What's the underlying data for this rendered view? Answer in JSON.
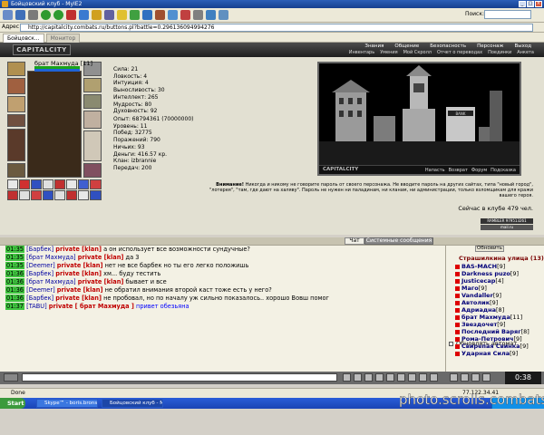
{
  "window": {
    "title": "Бойцовский клуб - MyIE2"
  },
  "search": {
    "label": "Поиск:",
    "value": ""
  },
  "address": {
    "label": "Адрес",
    "url": "http://capitalcity.combats.ru/buttons.pl?battle=0.296136094994276"
  },
  "tabs": [
    {
      "label": "Бойцовск..."
    },
    {
      "label": "Монитор"
    }
  ],
  "game_nav": {
    "logo": "CAPITALCITY",
    "top_links": [
      "Знания",
      "Общение",
      "Безопасность",
      "Персонаж",
      "Выход"
    ],
    "sub_links": [
      "Инвентарь",
      "Умения",
      "Мой Скролл",
      "Отчет о переводах",
      "Поединки",
      "Анкета"
    ]
  },
  "character": {
    "name_line": "брат Махмуда [11]",
    "stats": [
      "Сила: 21",
      "Ловкость: 4",
      "Интуиция: 4",
      "Выносливость: 30",
      "Интеллект: 265",
      "Мудрость: 80",
      "Духовность: 92"
    ],
    "progress": [
      "Опыт: 68794361 (70000000)",
      "Уровень: 11",
      "Побед: 32775",
      "Поражений: 790",
      "Ничьих: 93",
      "Деньги: 416.57 кр.",
      "Клан: izbrannie",
      "Передач: 200"
    ]
  },
  "city": {
    "footer_logo": "CAPITALCITY",
    "footer_links": [
      "Напасть",
      "Возврат",
      "Форум",
      "Подсказка"
    ]
  },
  "warning": {
    "lead": "Внимание!",
    "text": "Никогда и никому не говорите пароль от своего персонажа. Не вводите пароль на других сайтах, типа \"новый город\", \"лотерея\", \"там, где дают на халяву\". Пароль не нужен ни паладинам, ни кланам, ни администрации, только взломщикам для кражи вашего героя."
  },
  "online_count": "Сейчас в клубе 479 чел.",
  "counters": [
    "RAMBLER 979513261",
    "mail.ru"
  ],
  "chat_tabs": {
    "chat": "Чат",
    "system": "Системные сообщения"
  },
  "chat": [
    {
      "time": "01:35",
      "nick": "[Барбек]",
      "priv": "private [klan]",
      "text": "а он использует все возможности сундучные?"
    },
    {
      "time": "01:35",
      "nick": "[брат Махмуда]",
      "priv": "private [klan]",
      "text": "да 3"
    },
    {
      "time": "01:35",
      "nick": "[Deemer]",
      "priv": "private [klan]",
      "text": "нет не все барбек но ты его легко положишь"
    },
    {
      "time": "01:36",
      "nick": "[Барбек]",
      "priv": "private [klan]",
      "text": "хм... буду тестить"
    },
    {
      "time": "01:36",
      "nick": "[брат Махмуда]",
      "priv": "private [klan]",
      "text": "бывает и все"
    },
    {
      "time": "01:36",
      "nick": "[Deemer]",
      "priv": "private [klan]",
      "text": "не обратил внимания второй каст тоже есть у него?"
    },
    {
      "time": "01:36",
      "nick": "[Барбек]",
      "priv": "private [klan]",
      "text": "не пробовал, но по началу уж сильно показалось.. хорошо Вовш помог"
    },
    {
      "time": "01:37",
      "nick": "[TABU]",
      "priv": "private [ брат Махмуда ]",
      "text": "привет обезьяна"
    }
  ],
  "online_list": {
    "refresh_label": "Обновить",
    "street": "Страшилкина улица (13)",
    "users": [
      {
        "name": "BAS-MACH",
        "level": "[9]"
      },
      {
        "name": "Darkness puzo",
        "level": "[9]"
      },
      {
        "name": "Justicecap",
        "level": "[4]"
      },
      {
        "name": "Маго",
        "level": "[9]"
      },
      {
        "name": "Vandaller",
        "level": "[9]"
      },
      {
        "name": "Автолик",
        "level": "[9]"
      },
      {
        "name": "Адриадна",
        "level": "[8]"
      },
      {
        "name": "брат Махмуда",
        "level": "[11]"
      },
      {
        "name": "Звездочет",
        "level": "[9]"
      },
      {
        "name": "Последний Варяг",
        "level": "[8]"
      },
      {
        "name": "Рома-Петрович",
        "level": "[9]"
      },
      {
        "name": "Свирепая Свинка",
        "level": "[9]"
      },
      {
        "name": "Ударная Сила",
        "level": "[9]"
      }
    ],
    "auto_refresh": "Обновлять автомат."
  },
  "clock": "0:38",
  "status": {
    "left": "Done",
    "right": "77.122.34.41"
  },
  "taskbar": {
    "start": "Start",
    "tasks": [
      "Skype™ - boris.bronstei...",
      "Бойцовский клуб - M..."
    ]
  },
  "watermark": "photo.scrolls.combats.ru",
  "colors": {
    "hp": "#1aa21a",
    "mana": "#1f63d6",
    "time_badge": "#3fc43f",
    "private": "#c00000"
  }
}
